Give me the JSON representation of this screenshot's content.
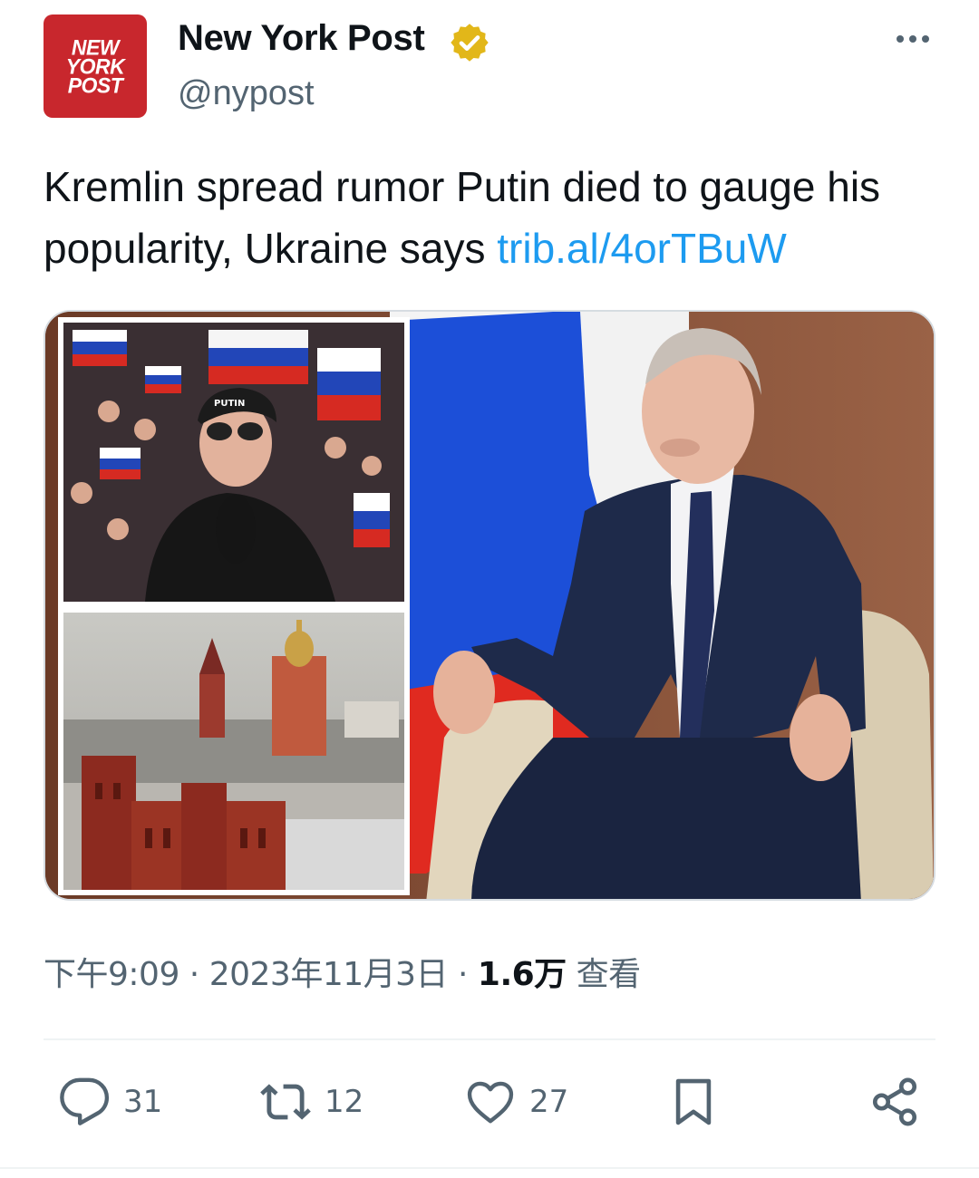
{
  "author": {
    "logo_lines": [
      "NEW",
      "YORK",
      "POST"
    ],
    "name": "New York Post",
    "handle": "@nypost",
    "verified_badge_color": "#e2b719"
  },
  "tweet": {
    "text": "Kremlin spread rumor Putin died to gauge his popularity, Ukraine says ",
    "link": "trib.al/4orTBuW"
  },
  "media": {
    "inset_top_sign": "PUTIN"
  },
  "meta": {
    "time": "下午9:09",
    "date": "2023年11月3日",
    "views_count": "1.6万",
    "views_label": "查看",
    "separator": "·"
  },
  "actions": {
    "reply_count": "31",
    "retweet_count": "12",
    "like_count": "27"
  },
  "icons": [
    "more-icon",
    "verified-icon",
    "reply-icon",
    "retweet-icon",
    "like-icon",
    "bookmark-icon",
    "share-icon"
  ],
  "colors": {
    "link": "#1d9bf0",
    "secondary_text": "#536471",
    "primary_text": "#0f1419",
    "logo_red": "#c8272d"
  }
}
